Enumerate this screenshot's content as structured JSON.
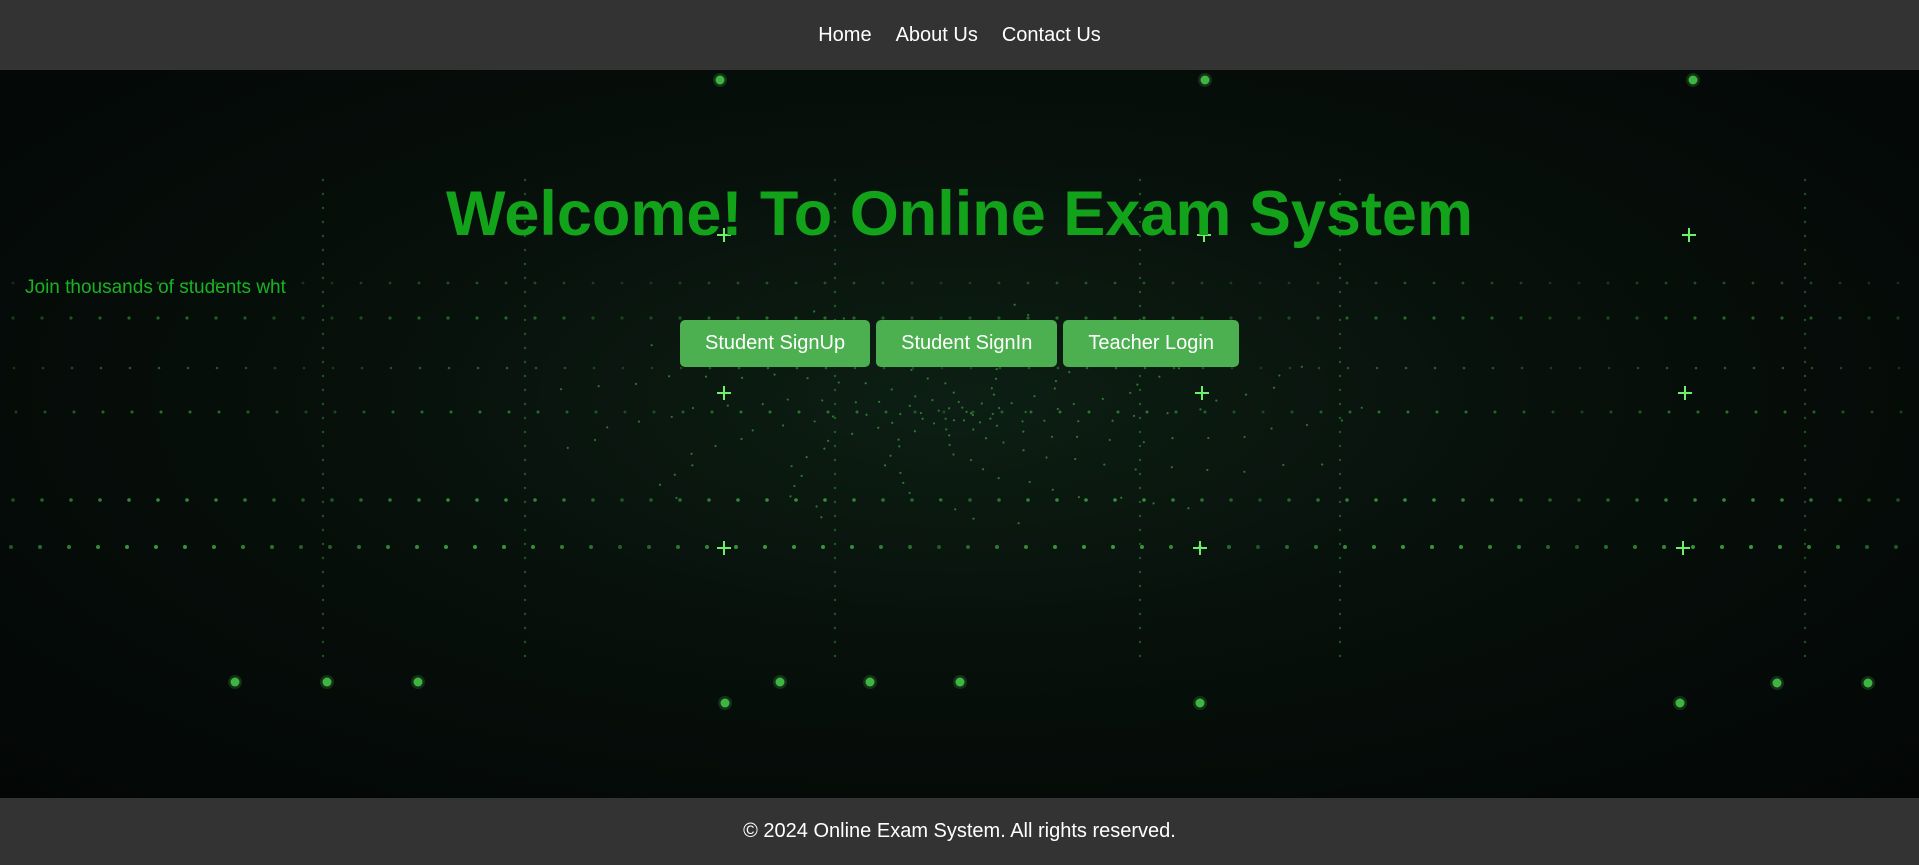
{
  "nav": {
    "links": [
      "Home",
      "About Us",
      "Contact Us"
    ]
  },
  "hero": {
    "title": "Welcome! To Online Exam System",
    "tagline": "Join thousands of students wht",
    "buttons": {
      "student_signup": "Student SignUp",
      "student_signin": "Student SignIn",
      "teacher_login": "Teacher Login"
    },
    "background": "green-digital-particle-grid"
  },
  "footer": {
    "text": "© 2024 Online Exam System. All rights reserved."
  },
  "colors": {
    "nav_bg": "#333333",
    "title_green": "#13a31b",
    "button_green": "#4caf50",
    "text_white": "#ffffff"
  }
}
